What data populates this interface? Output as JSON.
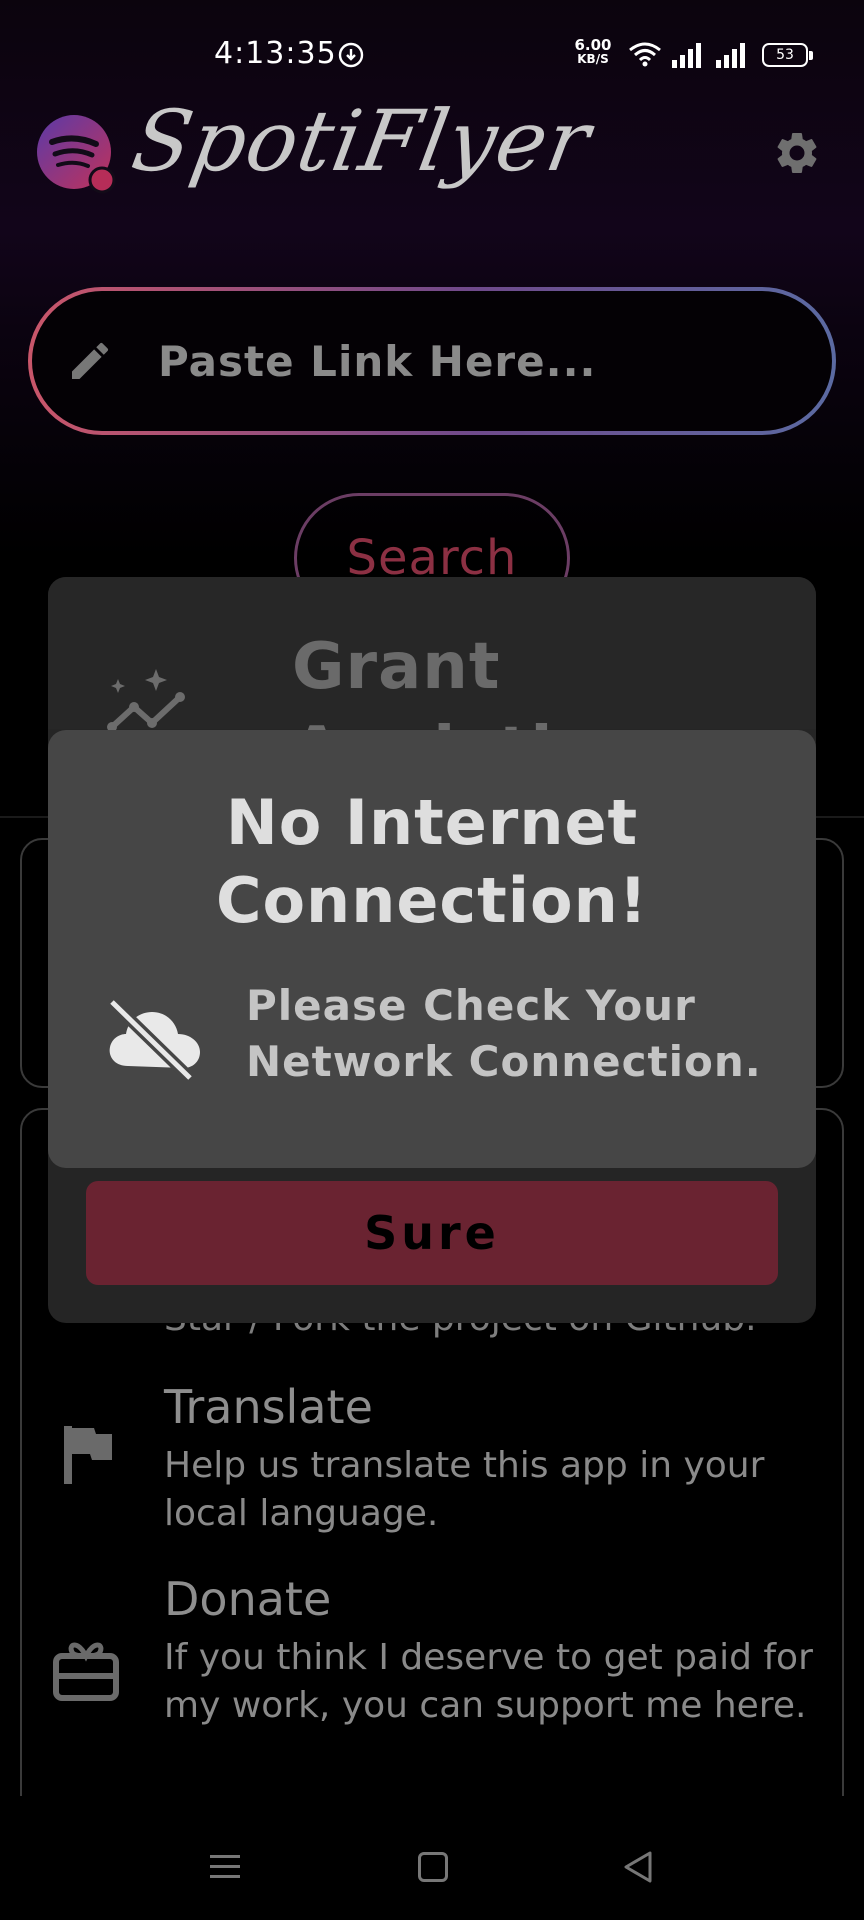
{
  "status_bar": {
    "time": "4:13:35",
    "net_speed_value": "6.00",
    "net_speed_unit": "KB/S",
    "battery": "53"
  },
  "header": {
    "app_title": "SpotiFlyer",
    "logo_icon": "spotiflyer-logo-icon",
    "settings_icon": "gear-icon"
  },
  "search": {
    "placeholder": "Paste Link Here...",
    "button_label": "Search"
  },
  "analytics_dialog": {
    "title_line1": "Grant",
    "title_line2": "Analytics",
    "confirm_label": "Sure"
  },
  "network_dialog": {
    "title_line1": "No Internet",
    "title_line2": "Connection!",
    "message": "Please Check Your Network Connection.",
    "icon": "cloud-off-icon"
  },
  "about_list": {
    "star_fork_text": "Star / Fork the project on Github.",
    "items": [
      {
        "title": "Translate",
        "desc": "Help us translate this app in your local language.",
        "icon": "flag-icon"
      },
      {
        "title": "Donate",
        "desc": "If you think I deserve to get paid for my work, you can support me here.",
        "icon": "gift-icon"
      }
    ]
  },
  "colors": {
    "accent": "#8c3043",
    "button_bg": "#6a2331",
    "dialog_bg": "#464646"
  }
}
